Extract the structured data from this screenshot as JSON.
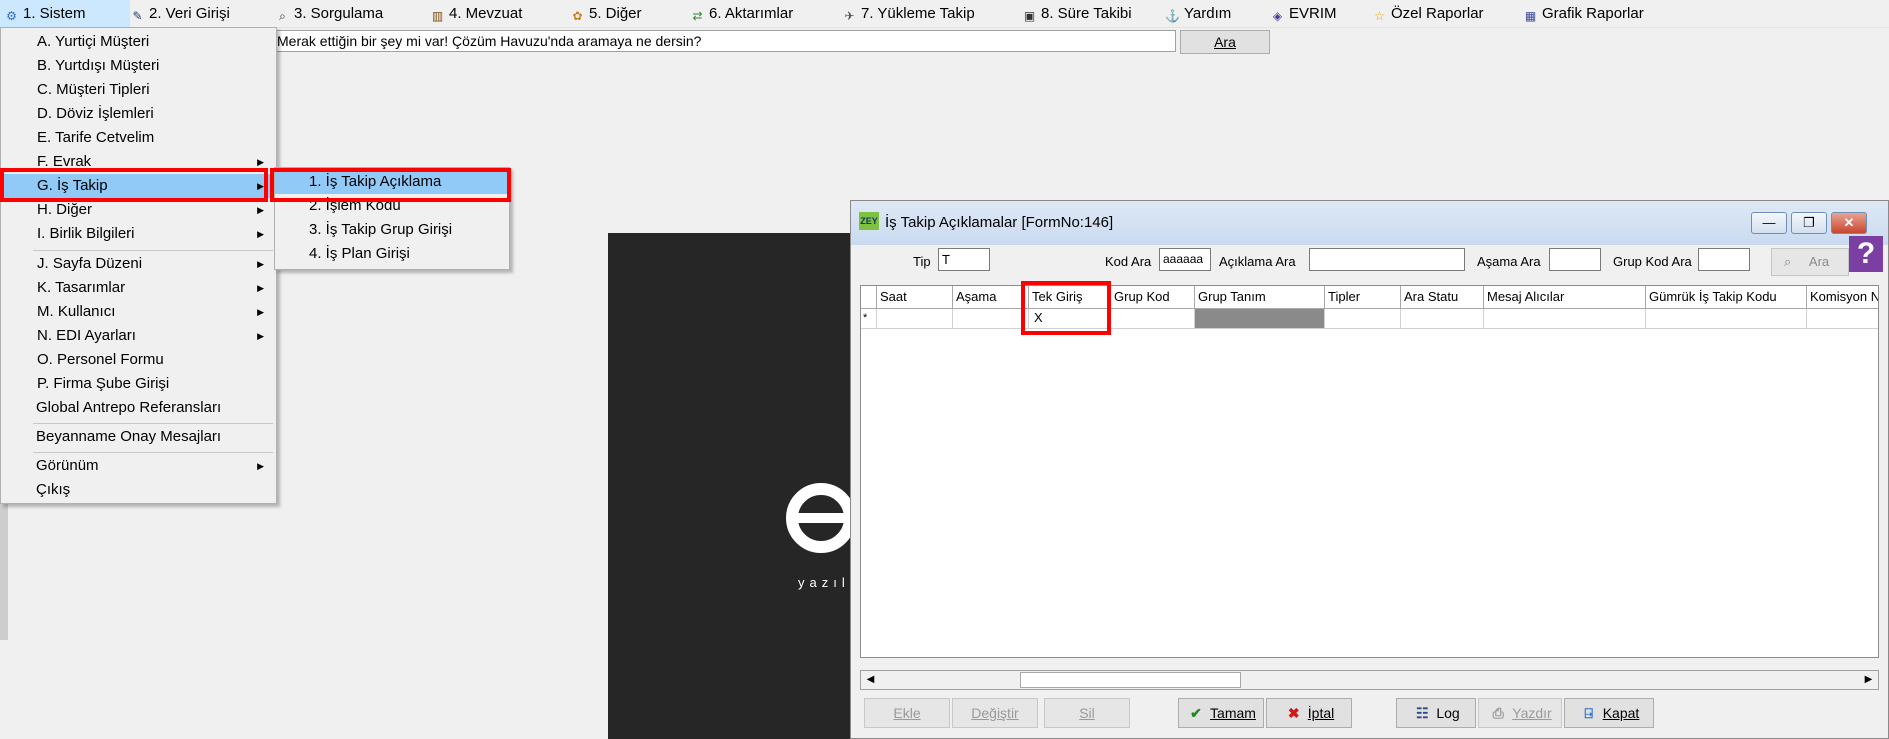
{
  "menubar": {
    "items": [
      {
        "icon": "sistem-icon",
        "label": "1.  Sistem"
      },
      {
        "icon": "veri-girisi-icon",
        "label": "2.  Veri Girişi"
      },
      {
        "icon": "sorgulama-icon",
        "label": "3.  Sorgulama"
      },
      {
        "icon": "mevzuat-icon",
        "label": "4.  Mevzuat"
      },
      {
        "icon": "diger-icon",
        "label": "5.  Diğer"
      },
      {
        "icon": "aktarimlar-icon",
        "label": "6.  Aktarımlar"
      },
      {
        "icon": "yukleme-takip-icon",
        "label": "7.  Yükleme Takip"
      },
      {
        "icon": "sure-takibi-icon",
        "label": "8. Süre Takibi"
      },
      {
        "icon": "yardim-icon",
        "label": "Yardım"
      },
      {
        "icon": "evrim-icon",
        "label": "EVRIM"
      },
      {
        "icon": "star-icon",
        "label": "Özel Raporlar"
      },
      {
        "icon": "grafik-icon",
        "label": "Grafik Raporlar"
      }
    ]
  },
  "search": {
    "text": "Merak ettiğin bir şey mi var! Çözüm Havuzu'nda aramaya ne dersin?",
    "button": "Ara"
  },
  "splash": {
    "logo_letter": "e",
    "tagline": "yazılı"
  },
  "sistem_menu": {
    "items": [
      {
        "label": "A.  Yurtiçi Müşteri",
        "has_sub": false
      },
      {
        "label": "B.  Yurtdışı Müşteri",
        "has_sub": false
      },
      {
        "label": "C.  Müşteri Tipleri",
        "has_sub": false
      },
      {
        "label": "D.  Döviz İşlemleri",
        "has_sub": false
      },
      {
        "label": "E.  Tarife Cetvelim",
        "has_sub": false
      },
      {
        "label": "F.  Evrak",
        "has_sub": true
      },
      {
        "label": "G.  İş Takip",
        "has_sub": true
      },
      {
        "label": "H.  Diğer",
        "has_sub": true
      },
      {
        "label": "I.  Birlik Bilgileri",
        "has_sub": true
      },
      {
        "label": "J.  Sayfa Düzeni",
        "has_sub": true
      },
      {
        "label": "K.  Tasarımlar",
        "has_sub": true
      },
      {
        "label": "M.  Kullanıcı",
        "has_sub": true
      },
      {
        "label": "N.  EDI Ayarları",
        "has_sub": true
      },
      {
        "label": "O.  Personel Formu",
        "has_sub": false
      },
      {
        "label": "P.  Firma Şube Girişi",
        "has_sub": false
      },
      {
        "label": "Global Antrepo Referansları",
        "has_sub": false
      },
      {
        "label": "Beyanname Onay Mesajları",
        "has_sub": false
      },
      {
        "label": "Görünüm",
        "has_sub": true
      },
      {
        "label": "Çıkış",
        "has_sub": false
      }
    ]
  },
  "is_takip_submenu": {
    "items": [
      "1.  İş  Takip Açıklama",
      "2.  İşlem Kodu",
      "3.  İş Takip Grup Girişi",
      "4.  İş Plan Girişi"
    ]
  },
  "form": {
    "title": "İş Takip Açıklamalar [FormNo:146]",
    "icon_text": "ZEY",
    "window_buttons": {
      "minimize": "—",
      "maximize": "❐",
      "close": "✕"
    },
    "filters": {
      "tip_label": "Tip",
      "tip_value": "T",
      "kod_ara_label": "Kod Ara",
      "kod_ara_value": "aaaaaa",
      "aciklama_label": "Açıklama  Ara",
      "aciklama_value": "",
      "asama_label": "Aşama Ara",
      "asama_value": "",
      "grup_kod_label": "Grup Kod Ara",
      "grup_kod_value": "",
      "ara_button": "Ara",
      "help": "?"
    },
    "grid": {
      "new_row_marker": "*",
      "columns": [
        "Saat",
        "Aşama",
        "Tek Giriş",
        "Grup Kod",
        "Grup Tanım",
        "Tipler",
        "Ara Statu",
        "Mesaj Alıcılar",
        "Gümrük İş Takip Kodu",
        "Komisyon No"
      ],
      "new_row_values": [
        "",
        "",
        "X",
        "",
        "",
        "",
        "",
        "",
        "",
        ""
      ]
    },
    "buttons": {
      "ekle": "Ekle",
      "degistir": "Değiştir",
      "sil": "Sil",
      "tamam": "Tamam",
      "iptal": "İptal",
      "log": "Log",
      "yazdir": "Yazdır",
      "kapat": "Kapat"
    }
  }
}
